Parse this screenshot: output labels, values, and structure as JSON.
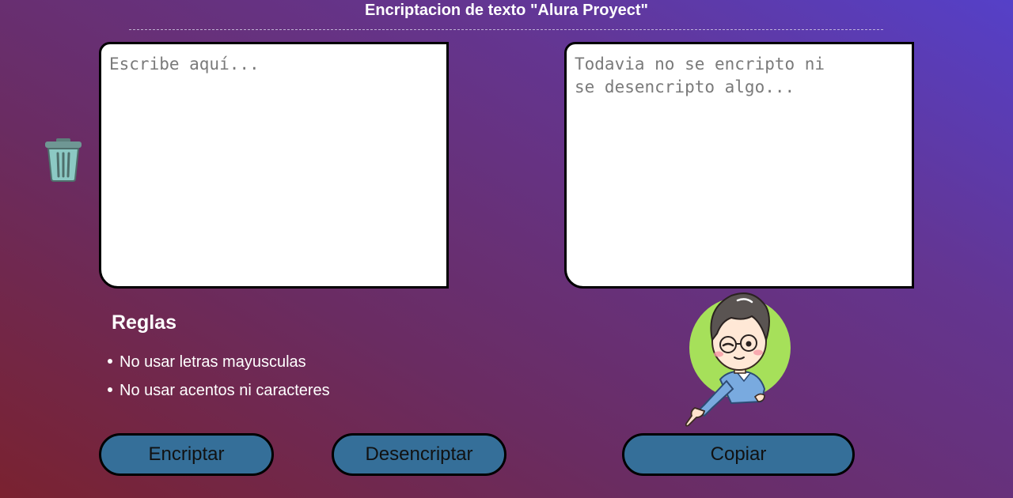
{
  "header": {
    "title": "Encriptacion de texto \"Alura Proyect\""
  },
  "input": {
    "placeholder": "Escribe aquí...",
    "value": ""
  },
  "output": {
    "placeholder": "Todavia no se encripto ni\nse desencripto algo...",
    "value": ""
  },
  "icons": {
    "clear": "trash-icon",
    "mascot": "pointing-boy-avatar"
  },
  "rules": {
    "title": "Reglas",
    "items": [
      "No usar letras mayusculas",
      "No usar acentos ni caracteres"
    ]
  },
  "buttons": {
    "encrypt": "Encriptar",
    "decrypt": "Desencriptar",
    "copy": "Copiar"
  },
  "colors": {
    "button_bg": "#356f99",
    "mascot_circle": "#a6e05a",
    "trash": "#8cc9c4"
  }
}
